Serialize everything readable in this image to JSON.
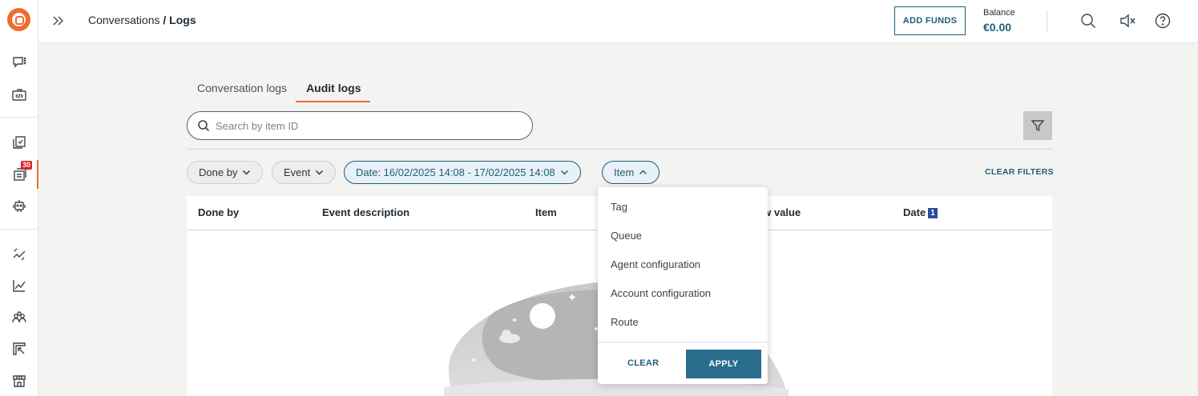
{
  "sidebar": {
    "icons": [
      "chat-icon",
      "code-icon",
      "copy-icon",
      "inbox-icon",
      "robot-icon",
      "flow-icon",
      "chart-icon",
      "people-icon",
      "transfer-icon",
      "store-icon"
    ],
    "badge": "30"
  },
  "topbar": {
    "breadcrumb_parent": "Conversations",
    "breadcrumb_separator": "/",
    "breadcrumb_current": "Logs",
    "add_funds_label": "ADD FUNDS",
    "balance_label": "Balance",
    "balance_value": "€0.00"
  },
  "tabs": [
    {
      "label": "Conversation logs",
      "active": false
    },
    {
      "label": "Audit logs",
      "active": true
    }
  ],
  "search": {
    "placeholder": "Search by item ID",
    "value": ""
  },
  "filters": {
    "done_by": "Done by",
    "event": "Event",
    "date": "Date: 16/02/2025 14:08 - 17/02/2025 14:08",
    "item": "Item",
    "clear_filters": "CLEAR FILTERS"
  },
  "table": {
    "columns": [
      "Done by",
      "Event description",
      "Item",
      "New value",
      "Date"
    ],
    "visible_new_value": "ew value",
    "sort_badge": "1",
    "rows": []
  },
  "dropdown": {
    "options": [
      "Tag",
      "Queue",
      "Agent configuration",
      "Account configuration",
      "Route"
    ],
    "clear_label": "CLEAR",
    "apply_label": "APPLY"
  },
  "colors": {
    "accent": "#f26b2f",
    "primary": "#1f5d7a",
    "badge": "#d8232a"
  }
}
